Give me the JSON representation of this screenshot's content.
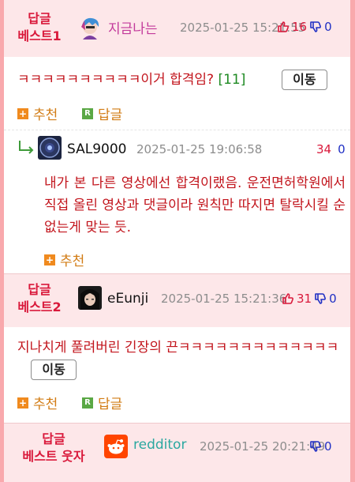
{
  "best1": {
    "label_line1": "답글",
    "label_line2": "베스트1",
    "nickname": "지금나는",
    "date": "2025-01-25 15:21:55",
    "up": "16",
    "down": "0",
    "text": "ㅋㅋㅋㅋㅋㅋㅋㅋㅋㅋ이거 합격임?",
    "count": "[11]",
    "move_label": "이동",
    "recommend_label": "추천",
    "reply_label": "답글"
  },
  "reply1": {
    "nickname": "SAL9000",
    "date": "2025-01-25 19:06:58",
    "up": "34",
    "down": "0",
    "text": "내가 본 다른 영상에선 합격이랬음. 운전면허학원에서 직접 올린 영상과 댓글이라 원칙만 따지면 탈락시킬 순 없는게 맞는 듯.",
    "recommend_label": "추천"
  },
  "best2": {
    "label_line1": "답글",
    "label_line2": "베스트2",
    "nickname": "eEunji",
    "date": "2025-01-25 15:21:36",
    "up": "31",
    "down": "0",
    "text": "지나치게 풀려버린 긴장의 끈ㅋㅋㅋㅋㅋㅋㅋㅋㅋㅋㅋㅋㅋ",
    "move_label": "이동",
    "recommend_label": "추천",
    "reply_label": "답글"
  },
  "best3": {
    "label_line1": "답글",
    "label_line2": "베스트 웃자",
    "nickname": "redditor",
    "date": "2025-01-25 20:21:49",
    "up": "",
    "down": "0"
  },
  "colors": {
    "accent": "#d9193b",
    "header_bg": "#fde7e9",
    "text_red": "#c2141c",
    "action_orange": "#d27c15",
    "count_green": "#1e8a22",
    "down_blue": "#1f2fc4"
  }
}
